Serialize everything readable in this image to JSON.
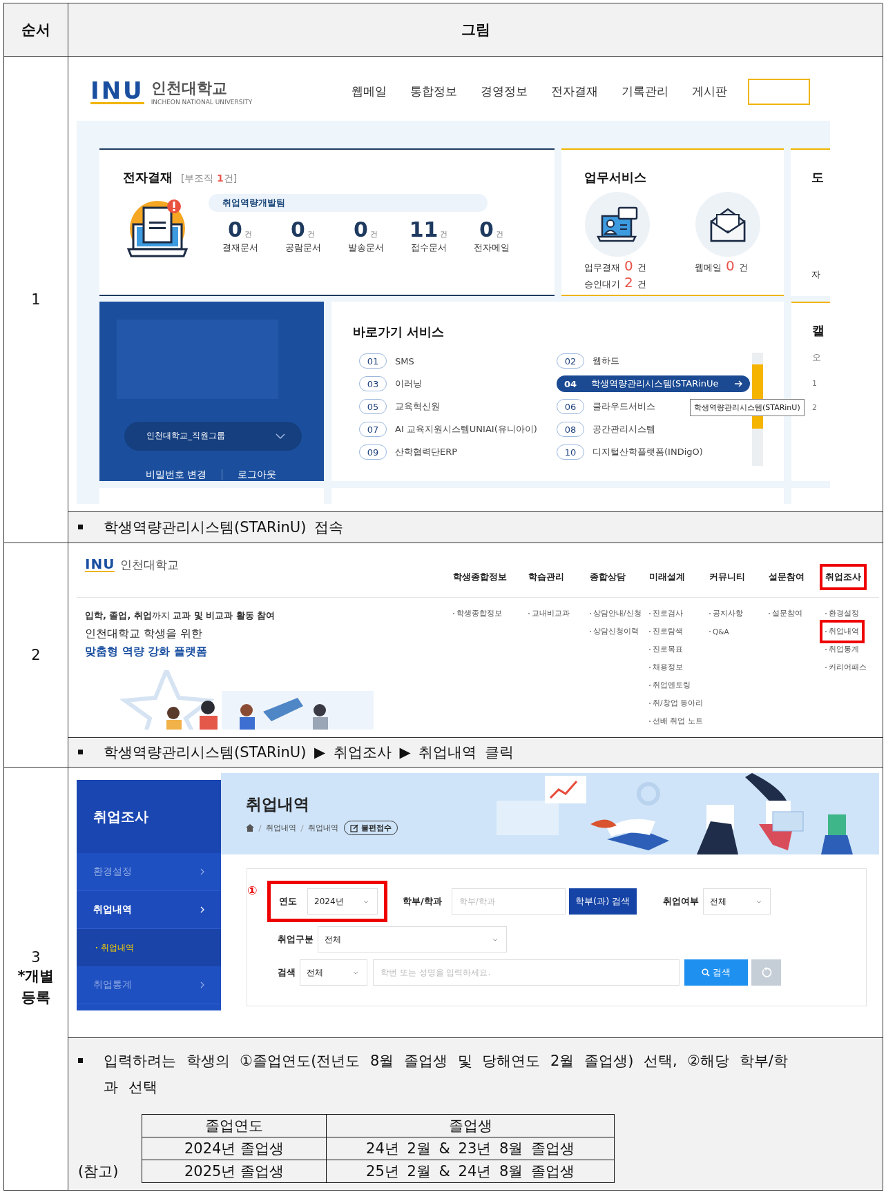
{
  "table": {
    "columns": [
      "순서",
      "그림"
    ]
  },
  "steps": [
    {
      "number": "1",
      "screen": {
        "kind": "portal",
        "logo": {
          "mark": "INU",
          "name": "인천대학교",
          "subtitle": "INCHEON NATIONAL UNIVERSITY"
        },
        "nav": [
          "웹메일",
          "통합정보",
          "경영정보",
          "전자결재",
          "기록관리",
          "게시판"
        ],
        "approval": {
          "title": "전자결재",
          "note": "[부조직 **1**건]",
          "team": "취업역량개발팀",
          "counts": [
            {
              "value": "0",
              "unit": "건",
              "label": "결재문서"
            },
            {
              "value": "0",
              "unit": "건",
              "label": "공람문서"
            },
            {
              "value": "0",
              "unit": "건",
              "label": "발송문서"
            },
            {
              "value": "11",
              "unit": "건",
              "label": "접수문서"
            },
            {
              "value": "0",
              "unit": "건",
              "label": "전자메일"
            }
          ]
        },
        "work": {
          "title": "업무서비스",
          "items": [
            {
              "stats": [
                {
                  "label": "업무결재",
                  "value": "0",
                  "unit": "건"
                },
                {
                  "label": "승인대기",
                  "value": "2",
                  "unit": "건"
                }
              ]
            },
            {
              "stats": [
                {
                  "label": "웹메일",
                  "value": "0",
                  "unit": "건"
                }
              ]
            }
          ]
        },
        "library": {
          "title": "도",
          "label": "자"
        },
        "profile": {
          "group": "인천대학교_직원그룹",
          "links": [
            "비밀번호 변경",
            "로그아웃"
          ]
        },
        "shortcuts": {
          "title": "바로가기 서비스",
          "tooltip": "학생역량관리시스템(STARinU)",
          "items": [
            {
              "number": "01",
              "label": "SMS",
              "selected": false
            },
            {
              "number": "02",
              "label": "웹하드",
              "selected": false
            },
            {
              "number": "03",
              "label": "이러닝",
              "selected": false
            },
            {
              "number": "04",
              "label": "학생역량관리시스템(STARinUe",
              "selected": true
            },
            {
              "number": "05",
              "label": "교육혁신원",
              "selected": false
            },
            {
              "number": "06",
              "label": "클라우드서비스",
              "selected": false
            },
            {
              "number": "07",
              "label": "AI 교육지원시스템UNIAI(유니아이)",
              "selected": false
            },
            {
              "number": "08",
              "label": "공간관리시스템",
              "selected": false
            },
            {
              "number": "09",
              "label": "산학협력단ERP",
              "selected": false
            },
            {
              "number": "10",
              "label": "디지털산학플랫폼(INDigO)",
              "selected": false
            }
          ]
        },
        "calendar": {
          "title": "캘",
          "label": "오",
          "numbers": [
            "1",
            "2"
          ]
        }
      },
      "caption": "학생역량관리시스템(STARinU) 접속"
    },
    {
      "number": "2",
      "screen": {
        "kind": "menu",
        "logo": {
          "mark": "INU",
          "name": "인천대학교"
        },
        "tagline": "**입학, 졸업, 취업**까지 **교과 및 비교과 활동 참여**",
        "subtitle": "인천대학교 학생을 위한",
        "headline": "맞춤형 역량 강화 플랫폼",
        "columns": [
          {
            "title": "학생종합정보",
            "highlighted": false,
            "items": [
              {
                "label": "학생종합정보",
                "highlighted": false
              }
            ]
          },
          {
            "title": "학습관리",
            "highlighted": false,
            "items": [
              {
                "label": "교내비교과",
                "highlighted": false
              }
            ]
          },
          {
            "title": "종합상담",
            "highlighted": false,
            "items": [
              {
                "label": "상담안내/신청",
                "highlighted": false
              },
              {
                "label": "상담신청이력",
                "highlighted": false
              }
            ]
          },
          {
            "title": "미래설계",
            "highlighted": false,
            "items": [
              {
                "label": "진로검사",
                "highlighted": false
              },
              {
                "label": "진로탐색",
                "highlighted": false
              },
              {
                "label": "진로목표",
                "highlighted": false
              },
              {
                "label": "채용정보",
                "highlighted": false
              },
              {
                "label": "취업멘토링",
                "highlighted": false
              },
              {
                "label": "취/창업 동아리",
                "highlighted": false
              },
              {
                "label": "선배 취업 노트",
                "highlighted": false
              }
            ]
          },
          {
            "title": "커뮤니티",
            "highlighted": false,
            "items": [
              {
                "label": "공지사항",
                "highlighted": false
              },
              {
                "label": "Q&A",
                "highlighted": false
              }
            ]
          },
          {
            "title": "설문참여",
            "highlighted": false,
            "items": [
              {
                "label": "설문참여",
                "highlighted": false
              }
            ]
          },
          {
            "title": "취업조사",
            "highlighted": true,
            "items": [
              {
                "label": "환경설정",
                "highlighted": false
              },
              {
                "label": "취업내역",
                "highlighted": true
              },
              {
                "label": "취업통계",
                "highlighted": false
              },
              {
                "label": "커리어패스",
                "highlighted": false
              }
            ]
          }
        ]
      },
      "caption": "학생역량관리시스템(STARinU) ▶ 취업조사 ▶ 취업내역 클릭"
    },
    {
      "number": "3",
      "note": "*개별 등록",
      "screen": {
        "kind": "search",
        "sidebar": {
          "title": "취업조사",
          "items": [
            {
              "label": "환경설정",
              "selected": false
            },
            {
              "label": "취업내역",
              "selected": true,
              "children": [
                {
                  "label": "취업내역",
                  "selected": true
                }
              ]
            },
            {
              "label": "취업통계",
              "selected": false
            }
          ]
        },
        "title": "취업내역",
        "breadcrumb": [
          "취업내역",
          "취업내역"
        ],
        "complaint_button": "불편접수",
        "filters": {
          "marker": "①",
          "year": {
            "label": "연도",
            "value": "2024년",
            "highlighted": true
          },
          "department": {
            "label": "학부/학과",
            "placeholder": "학부/학과",
            "button": "학부(과) 검색"
          },
          "employment": {
            "label": "취업여부",
            "value": "전체"
          },
          "category": {
            "label": "취업구분",
            "value": "전체"
          },
          "search": {
            "label": "검색",
            "scope": "전체",
            "placeholder": "학번 또는 성명을 입력하세요.",
            "button": "검색"
          }
        }
      },
      "caption": "입력하려는 학생의 ①졸업연도(전년도 8월 졸업생 및 당해연도 2월 졸업생) 선택, ②해당 학부/학과 선택",
      "reference": {
        "label": "(참고)",
        "columns": [
          "졸업연도",
          "졸업생"
        ],
        "rows": [
          [
            "2024년 졸업생",
            "24년 2월 & 23년 8월 졸업생"
          ],
          [
            "2025년 졸업생",
            "25년 2월 & 24년 8월 졸업생"
          ]
        ]
      }
    }
  ]
}
